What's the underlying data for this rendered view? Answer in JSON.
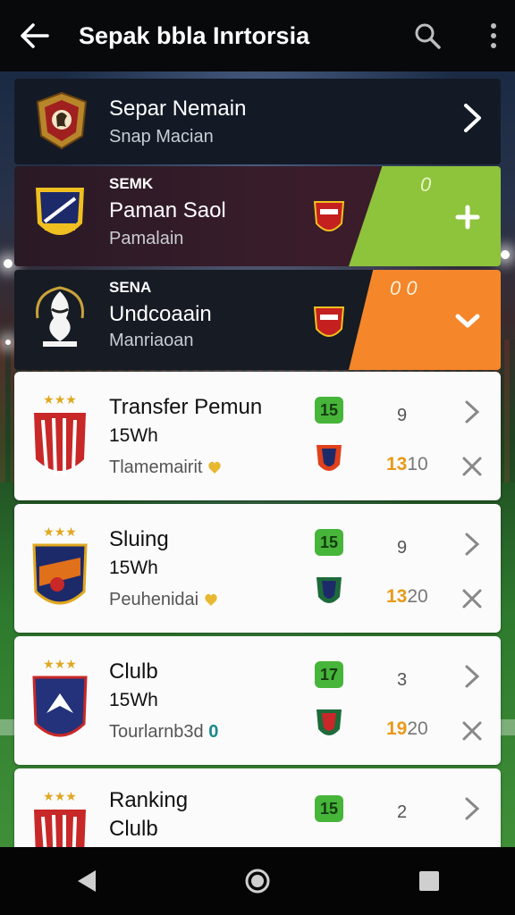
{
  "app": {
    "title": "Sepak bbla Inrtorsia"
  },
  "icons": {
    "back": "arrow-left-icon",
    "search": "search-icon",
    "more": "more-vertical-icon"
  },
  "colors": {
    "accent_green": "#8ec33c",
    "accent_orange": "#f5862a",
    "badge_green": "#46b53a",
    "points_orange": "#e89a1a"
  },
  "featured": [
    {
      "name": "Separ Nemain",
      "sub": "Snap Macian"
    },
    {
      "tag": "SEMK",
      "name": "Paman Saol",
      "sub": "Pamalain",
      "score": "0",
      "action": "plus"
    },
    {
      "tag": "SENA",
      "name": "Undcoaain",
      "sub": "Manriaoan",
      "score": "0 0",
      "action": "chevron-down"
    }
  ],
  "list": [
    {
      "title": "Transfer Pemun",
      "line2": "15Wh",
      "line3": "Tlamemairit",
      "badge": "15",
      "rank": "9",
      "points_hi": "13",
      "points_lo": "10"
    },
    {
      "title": "Sluing",
      "line2": "15Wh",
      "line3": "Peuhenidai",
      "badge": "15",
      "rank": "9",
      "points_hi": "13",
      "points_lo": "20"
    },
    {
      "title": "Clulb",
      "line2": "15Wh",
      "line3": "Tourlarnb3d",
      "line3_extra": "0",
      "badge": "17",
      "rank": "3",
      "points_hi": "19",
      "points_lo": "20"
    },
    {
      "title": "Ranking",
      "line2": "Clulb",
      "badge": "15",
      "rank": "2"
    }
  ]
}
